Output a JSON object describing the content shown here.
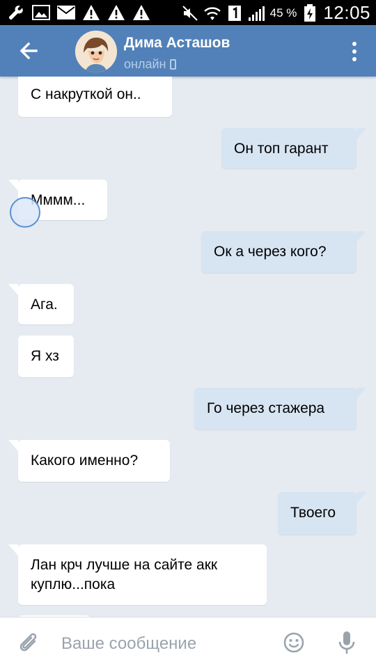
{
  "status_bar": {
    "icons": [
      "wrench-icon",
      "image-icon",
      "mail-icon",
      "warning-icon",
      "warning-icon",
      "warning-icon"
    ],
    "right_icons": [
      "mute-icon",
      "wifi-icon",
      "sim-1-icon",
      "signal-icon"
    ],
    "battery_percent": "45 %",
    "time": "12:05"
  },
  "header": {
    "contact_name": "Дима Асташов",
    "status": "онлайн"
  },
  "messages": [
    {
      "direction": "in",
      "text": "С накруткой он.."
    },
    {
      "direction": "out",
      "text": "Он топ гарант"
    },
    {
      "direction": "in",
      "text": "Мммм..."
    },
    {
      "direction": "out",
      "text": "Ок а через кого?"
    },
    {
      "direction": "in",
      "text": "Ага."
    },
    {
      "direction": "in",
      "text": "Я хз"
    },
    {
      "direction": "out",
      "text": "Го через стажера"
    },
    {
      "direction": "in",
      "text": "Какого именно?"
    },
    {
      "direction": "out",
      "text": "Твоего"
    },
    {
      "direction": "in",
      "text": "Лан крч лучше на сайте акк куплю...пока"
    }
  ],
  "input": {
    "placeholder": "Ваше сообщение"
  },
  "colors": {
    "header": "#5181b8",
    "chat_bg": "#e6ebf1",
    "incoming_bubble": "#ffffff",
    "outgoing_bubble": "#d7e4f2"
  }
}
